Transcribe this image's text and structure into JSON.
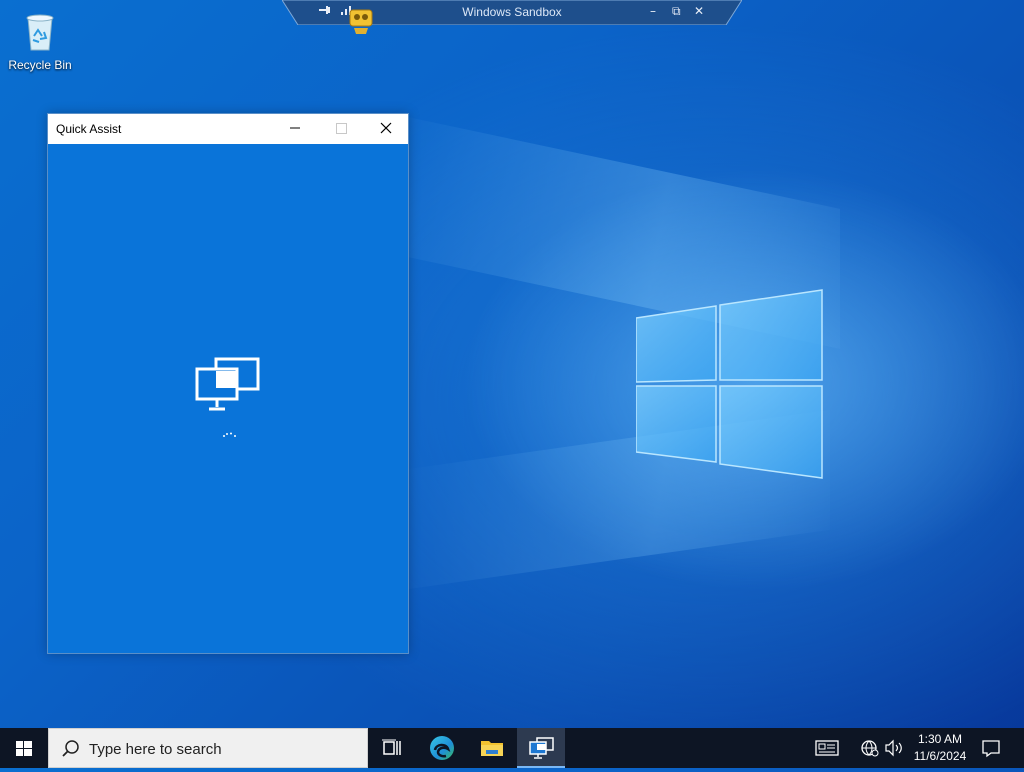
{
  "desktop": {
    "icons": [
      {
        "label": "Recycle Bin",
        "icon": "recycle-bin-icon"
      }
    ]
  },
  "sandbox_bar": {
    "title": "Windows Sandbox",
    "buttons": [
      "pin-icon",
      "connection-bars-icon",
      "minimize-icon",
      "restore-icon",
      "close-icon"
    ],
    "minimize_glyph": "–",
    "restore_glyph": "⧉",
    "close_glyph": "✕"
  },
  "quick_assist": {
    "title": "Quick Assist",
    "status": "loading",
    "accent": "#0a74d9"
  },
  "taskbar": {
    "search_placeholder": "Type here to search",
    "apps": [
      "task-view-icon",
      "edge-icon",
      "file-explorer-icon",
      "quick-assist-icon"
    ],
    "active_app": "quick-assist-icon",
    "clock_time": "1:30 AM",
    "clock_date": "11/6/2024"
  }
}
